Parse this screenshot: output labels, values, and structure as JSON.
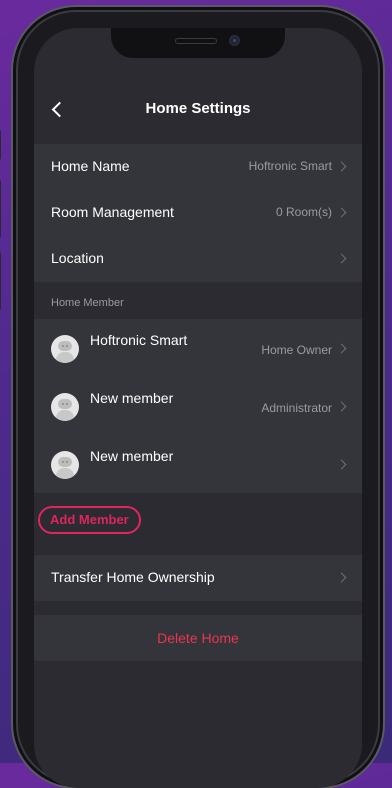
{
  "header": {
    "title": "Home Settings"
  },
  "settings": [
    {
      "label": "Home Name",
      "value": "Hoftronic Smart"
    },
    {
      "label": "Room Management",
      "value": "0 Room(s)"
    },
    {
      "label": "Location",
      "value": ""
    }
  ],
  "members_section": {
    "label": "Home Member",
    "members": [
      {
        "name": "Hoftronic Smart",
        "role": "Home Owner"
      },
      {
        "name": "New member",
        "role": "Administrator"
      },
      {
        "name": "New member",
        "role": ""
      }
    ],
    "add_label": "Add Member"
  },
  "transfer": {
    "label": "Transfer Home Ownership"
  },
  "delete": {
    "label": "Delete Home"
  },
  "colors": {
    "accent": "#e0245e",
    "danger": "#e8374e",
    "background": "#2b2b31",
    "row": "#34343b"
  }
}
